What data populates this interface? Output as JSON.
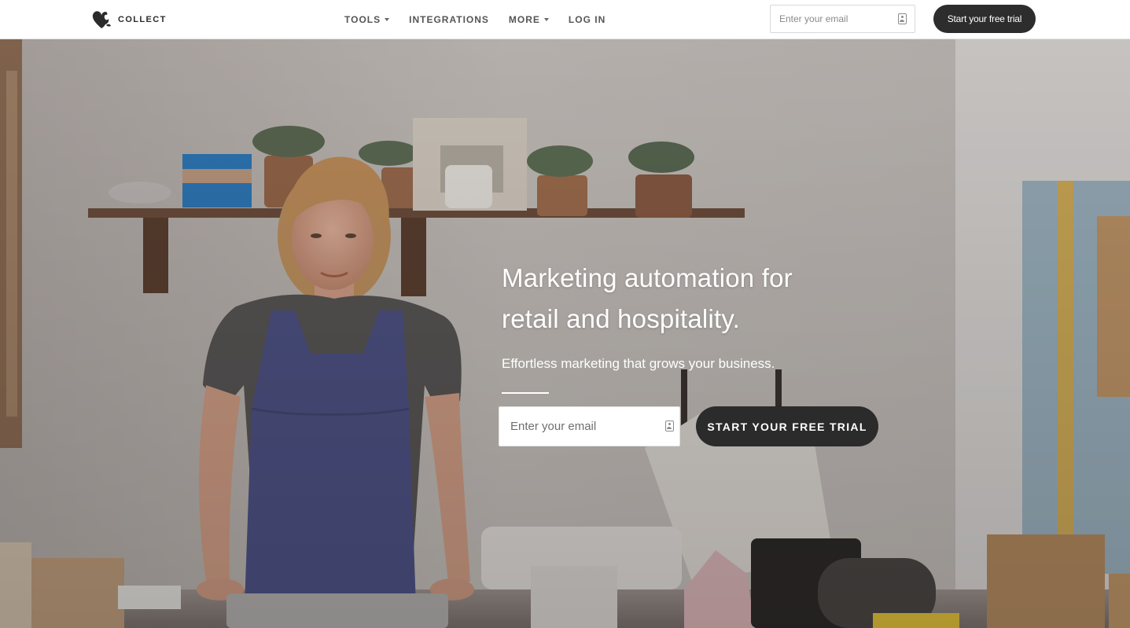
{
  "brand": {
    "name": "COLLECT",
    "logo_icon": "heart-leaf-logo-icon"
  },
  "nav": {
    "items": [
      {
        "label": "TOOLS",
        "has_dropdown": true
      },
      {
        "label": "INTEGRATIONS",
        "has_dropdown": false
      },
      {
        "label": "MORE",
        "has_dropdown": true
      },
      {
        "label": "LOG IN",
        "has_dropdown": false
      }
    ],
    "email_placeholder": "Enter your email",
    "cta_label": "Start your free trial"
  },
  "hero": {
    "title_line1": "Marketing automation for",
    "title_line2": "retail and hospitality.",
    "subtitle": "Effortless marketing that grows your business.",
    "email_placeholder": "Enter your email",
    "cta_label": "START YOUR FREE TRIAL",
    "background_image": "woman-in-apron-at-shop-counter-photo"
  },
  "colors": {
    "nav_bg": "#ffffff",
    "cta_bg": "#2d2d2d",
    "nav_text": "#555555",
    "hero_text": "#ffffff"
  }
}
